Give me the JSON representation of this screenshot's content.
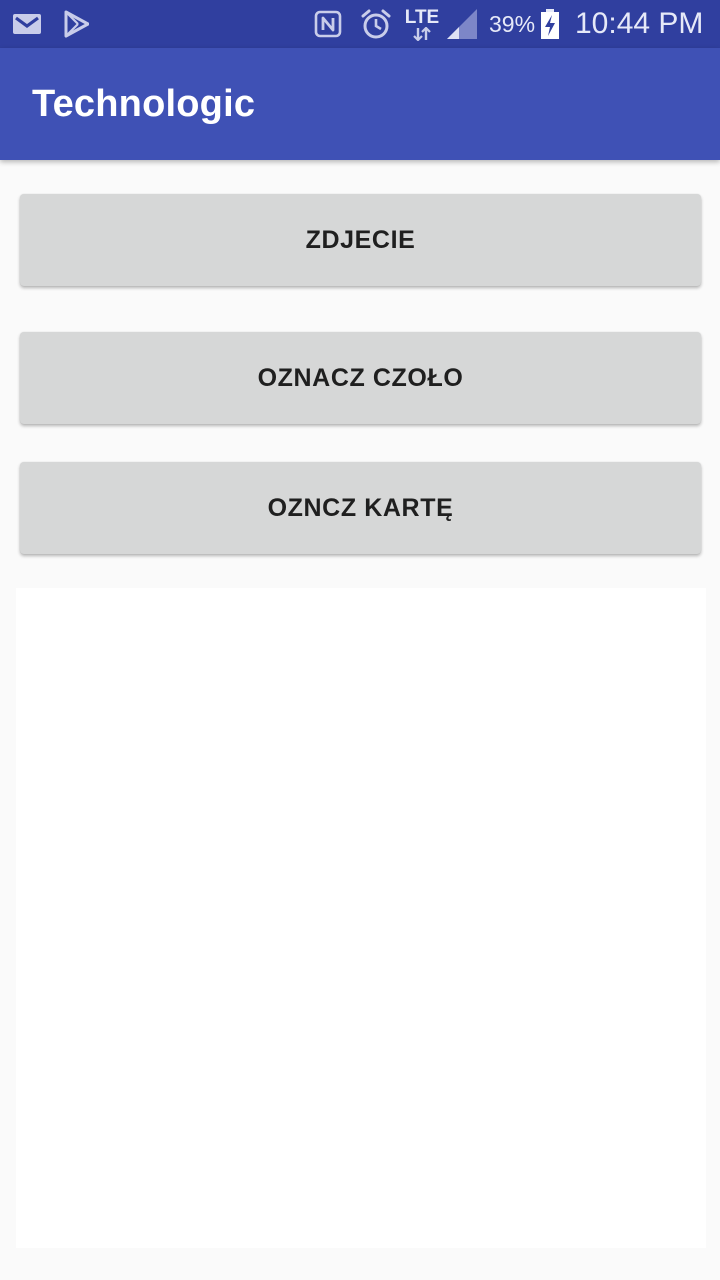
{
  "status_bar": {
    "icons": [
      "gmail-icon",
      "play-store-icon",
      "nfc-icon",
      "alarm-icon",
      "lte-icon",
      "signal-icon",
      "battery-charging-icon"
    ],
    "network_label": "LTE",
    "battery_percent": "39%",
    "battery_level": 0.39,
    "time": "10:44 PM"
  },
  "app_bar": {
    "title": "Technologic"
  },
  "buttons": {
    "photo_label": "ZDJECIE",
    "mark_forehead_label": "OZNACZ CZOŁO",
    "mark_card_label": "OZNCZ KARTĘ"
  },
  "colors": {
    "status_bar": "#303f9f",
    "app_bar": "#3f51b5",
    "button_bg": "#d6d7d7",
    "background": "#fafafa"
  }
}
